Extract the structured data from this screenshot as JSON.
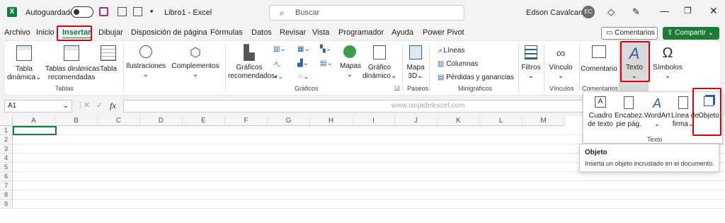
{
  "titlebar": {
    "autosave_label": "Autoguardado",
    "doc_title": "Libro1 - Excel",
    "search_placeholder": "Buscar",
    "user_name": "Edson Cavalcante",
    "user_initials": "EC"
  },
  "tabs": [
    "Archivo",
    "Inicio",
    "Insertar",
    "Dibujar",
    "Disposición de página",
    "Fórmulas",
    "Datos",
    "Revisar",
    "Vista",
    "Programador",
    "Ayuda",
    "Power Pivot"
  ],
  "active_tab": "Insertar",
  "comments_button": "Comentarios",
  "share_button": "Compartir",
  "ribbon": {
    "tabla_dinamica": [
      "Tabla",
      "dinámica"
    ],
    "tablas_recomendadas": [
      "Tablas dinámicas",
      "recomendadas"
    ],
    "tabla": "Tabla",
    "group_tablas": "Tablas",
    "ilustraciones": "Ilustraciones",
    "complementos": "Complementos",
    "graficos_recomendados": [
      "Gráficos",
      "recomendados"
    ],
    "mapas": "Mapas",
    "grafico_dinamico": [
      "Gráfico",
      "dinámico"
    ],
    "group_graficos": "Gráficos",
    "mapa3d": [
      "Mapa",
      "3D"
    ],
    "group_paseos": "Paseos",
    "lineas": "Líneas",
    "columnas": "Columnas",
    "perdidas": "Pérdidas y ganancias",
    "group_minigraficos": "Minigráficos",
    "filtros": "Filtros",
    "vinculo": "Vínculo",
    "group_vinculos": "Vínculos",
    "comentario": "Comentario",
    "group_comentarios": "Comentarios",
    "texto": "Texto",
    "simbolos": "Símbolos"
  },
  "formula_bar": {
    "name_box": "A1",
    "fx": "fx",
    "watermark": "www.ninjadelexcel.com"
  },
  "columns": [
    "A",
    "B",
    "C",
    "D",
    "E",
    "F",
    "G",
    "H",
    "I",
    "J",
    "K",
    "L",
    "M"
  ],
  "rows": [
    "1",
    "2",
    "3",
    "4",
    "5",
    "6",
    "7",
    "8",
    "9"
  ],
  "popup": {
    "cuadro": [
      "Cuadro",
      "de texto"
    ],
    "encabez": [
      "Encabez.",
      "pie pág."
    ],
    "wordart": "WordArt",
    "linea_firma": [
      "Línea de",
      "firma"
    ],
    "objeto": "Objeto",
    "group_label": "Texto"
  },
  "tooltip": {
    "title": "Objeto",
    "text": "Inserta un objeto incrustado en el documento."
  },
  "colors": {
    "excel_green": "#107c41",
    "highlight_red": "#d9000d",
    "share_green": "#1f7a3a"
  }
}
